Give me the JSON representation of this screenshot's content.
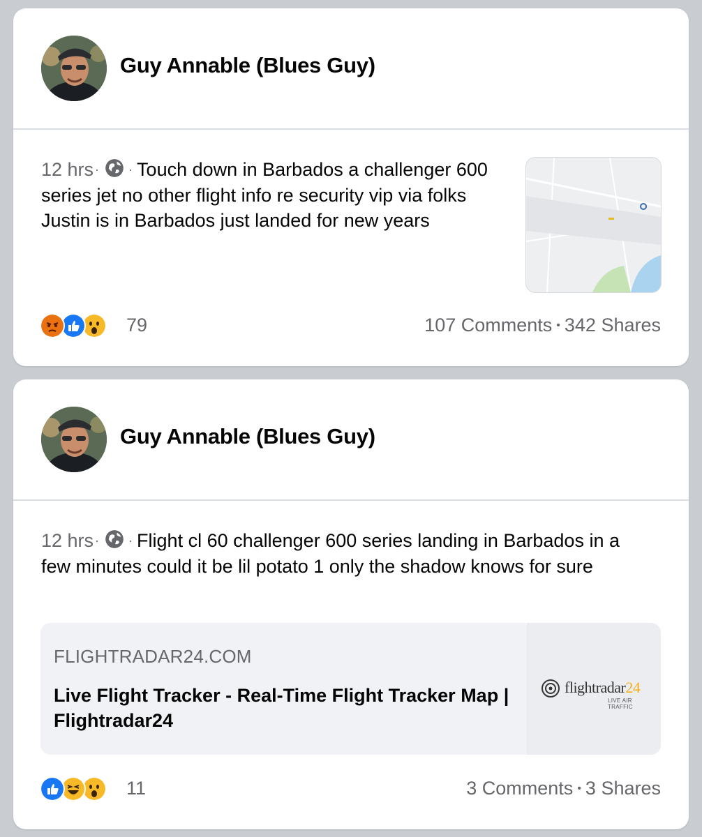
{
  "posts": [
    {
      "author": "Guy Annable (Blues Guy)",
      "time": "12 hrs",
      "text": "Touch down in Barbados  a challenger 600 series jet  no other flight info  re security vip via  folks  Justin is in Barbados just landed  for new years",
      "reactions": [
        "angry-icon",
        "like-icon",
        "wow-icon"
      ],
      "reaction_count": "79",
      "comments": "107 Comments",
      "shares": "342 Shares"
    },
    {
      "author": "Guy Annable (Blues Guy)",
      "time": "12 hrs",
      "text": "Flight cl 60  challenger 600 series landing in Barbados in a few minutes  could it be lil potato 1  only the shadow knows for sure",
      "link": {
        "domain": "FLIGHTRADAR24.COM",
        "title": "Live Flight Tracker - Real-Time Flight Tracker Map | Flightradar24",
        "logo_word": "flightradar",
        "logo_num": "24",
        "logo_sub": "LIVE AIR TRAFFIC"
      },
      "reactions": [
        "like-icon",
        "haha-icon",
        "wow-icon"
      ],
      "reaction_count": "11",
      "comments": "3 Comments",
      "shares": "3 Shares"
    }
  ],
  "separator": "·",
  "stats_separator": "•",
  "colors": {
    "background": "#c9ccd1",
    "card": "#ffffff",
    "secondary_text": "#65676b",
    "like_blue": "#1877f2",
    "angry_orange": "#e9710f",
    "wow_yellow": "#f7b928"
  }
}
